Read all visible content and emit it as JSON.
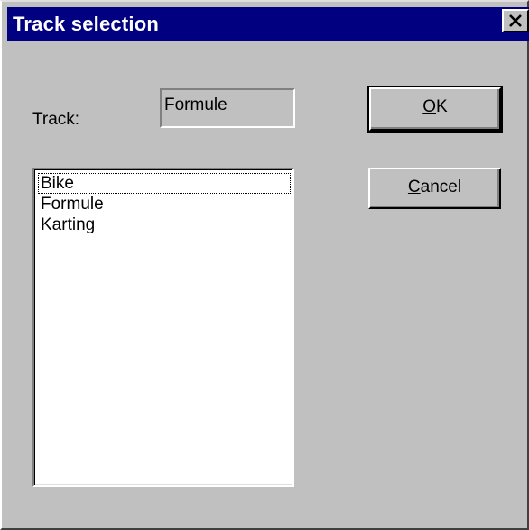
{
  "window": {
    "title": "Track selection"
  },
  "form": {
    "track_label": "Track:",
    "track_value": "Formule"
  },
  "list": {
    "items": [
      "Bike",
      "Formule",
      "Karting"
    ],
    "focused_index": 0
  },
  "buttons": {
    "ok": {
      "accel": "O",
      "rest": "K"
    },
    "cancel": {
      "accel": "C",
      "rest": "ancel"
    }
  },
  "colors": {
    "titlebar": "#000080",
    "face": "#c0c0c0"
  },
  "icons": {
    "close": "close-icon"
  }
}
